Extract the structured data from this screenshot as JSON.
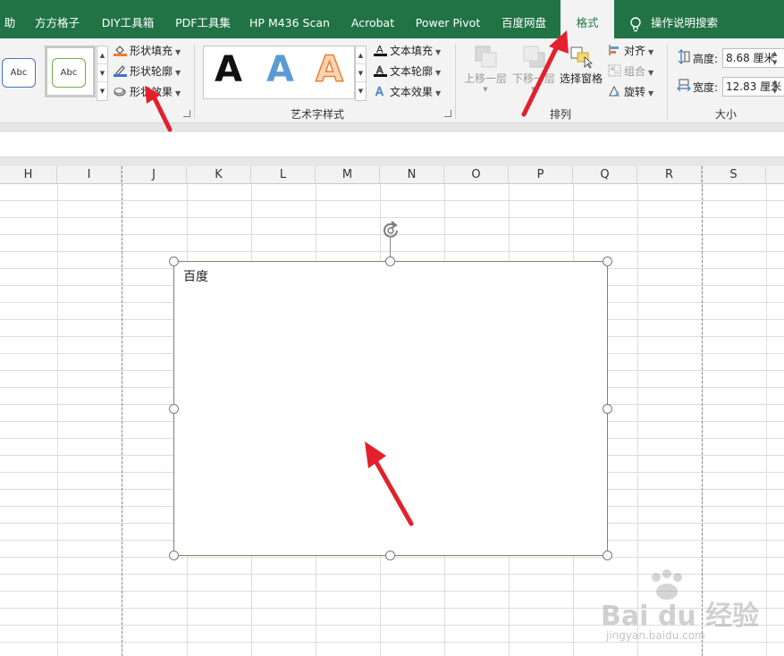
{
  "tabs": [
    {
      "label": "助"
    },
    {
      "label": "方方格子"
    },
    {
      "label": "DIY工具箱"
    },
    {
      "label": "PDF工具集"
    },
    {
      "label": "HP M436 Scan"
    },
    {
      "label": "Acrobat"
    },
    {
      "label": "Power Pivot"
    },
    {
      "label": "百度网盘"
    },
    {
      "label": "格式",
      "active": true
    }
  ],
  "tell_me": "操作说明搜索",
  "shape_styles": {
    "samples": [
      "Abc",
      "Abc"
    ],
    "fill_label": "形状填充",
    "outline_label": "形状轮廓",
    "effects_label": "形状效果"
  },
  "wordart": {
    "samples": [
      "A",
      "A",
      "A"
    ],
    "text_fill": "文本填充",
    "text_outline": "文本轮廓",
    "text_effects": "文本效果",
    "group_label": "艺术字样式"
  },
  "arrange": {
    "bring_forward": "上移一层",
    "send_backward": "下移一层",
    "selection_pane": "选择窗格",
    "align": "对齐",
    "group": "组合",
    "rotate": "旋转",
    "group_label": "排列"
  },
  "size": {
    "height_label": "高度:",
    "height_value": "8.68 厘米",
    "width_label": "宽度:",
    "width_value": "12.83 厘米",
    "group_label": "大小"
  },
  "columns": [
    "H",
    "I",
    "J",
    "K",
    "L",
    "M",
    "N",
    "O",
    "P",
    "Q",
    "R",
    "S"
  ],
  "shape": {
    "text": "百度"
  },
  "watermark": {
    "brand": "Bai du 经验",
    "url": "jingyan.baidu.com"
  },
  "colors": {
    "accent": "#217346",
    "arrow": "#e3202c"
  }
}
